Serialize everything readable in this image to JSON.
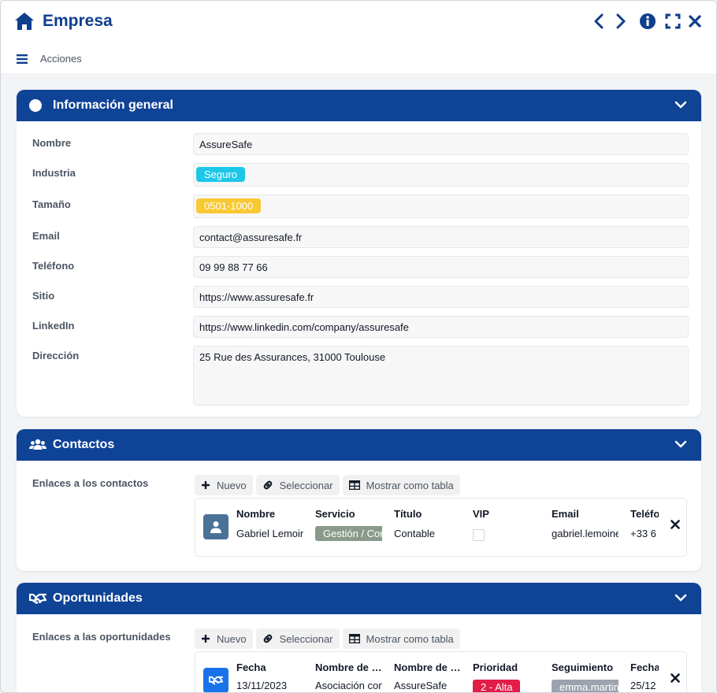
{
  "window": {
    "title": "Empresa",
    "actions_label": "Acciones"
  },
  "general": {
    "title": "Información general",
    "fields": [
      {
        "label": "Nombre",
        "value": "AssureSafe"
      },
      {
        "label": "Industria",
        "value": "Seguro",
        "badge_color": "#1ec7e8"
      },
      {
        "label": "Tamaño",
        "value": "0501-1000",
        "badge_color": "#f8c933"
      },
      {
        "label": "Email",
        "value": "contact@assuresafe.fr"
      },
      {
        "label": "Teléfono",
        "value": "09 99 88 77 66"
      },
      {
        "label": "Sitio",
        "value": "https://www.assuresafe.fr"
      },
      {
        "label": "LinkedIn",
        "value": "https://www.linkedin.com/company/assuresafe"
      },
      {
        "label": "Dirección",
        "value": "25 Rue des Assurances, 31000 Toulouse"
      }
    ]
  },
  "contacts": {
    "title": "Contactos",
    "links_label": "Enlaces a los contactos",
    "toolbar": {
      "new": "Nuevo",
      "select": "Seleccionar",
      "table": "Mostrar como tabla"
    },
    "columns": [
      "Nombre",
      "Servicio",
      "Título",
      "VIP",
      "Email",
      "Teléfono"
    ],
    "row": {
      "name": "Gabriel Lemoine",
      "service": "Gestión / Contabilidad",
      "title": "Contable",
      "vip": false,
      "email": "gabriel.lemoine@assuresafe.fr",
      "phone": "+33 6"
    }
  },
  "opportunities": {
    "title": "Oportunidades",
    "links_label": "Enlaces a las oportunidades",
    "toolbar": {
      "new": "Nuevo",
      "select": "Seleccionar",
      "table": "Mostrar como tabla"
    },
    "columns": [
      "Fecha",
      "Nombre de la oportunidad",
      "Nombre de la empresa",
      "Prioridad",
      "Seguimiento",
      "Fecha"
    ],
    "row": {
      "date": "13/11/2023",
      "name": "Asociación con AssureSafe",
      "company": "AssureSafe",
      "priority": "2 - Alta",
      "owner": "emma.martin",
      "date2": "25/12"
    }
  },
  "colors": {
    "primary": "#0f4396",
    "title": "#0f3e8c",
    "contact_avatar": "#4a7196",
    "opportunity_avatar": "#1a73e8"
  }
}
